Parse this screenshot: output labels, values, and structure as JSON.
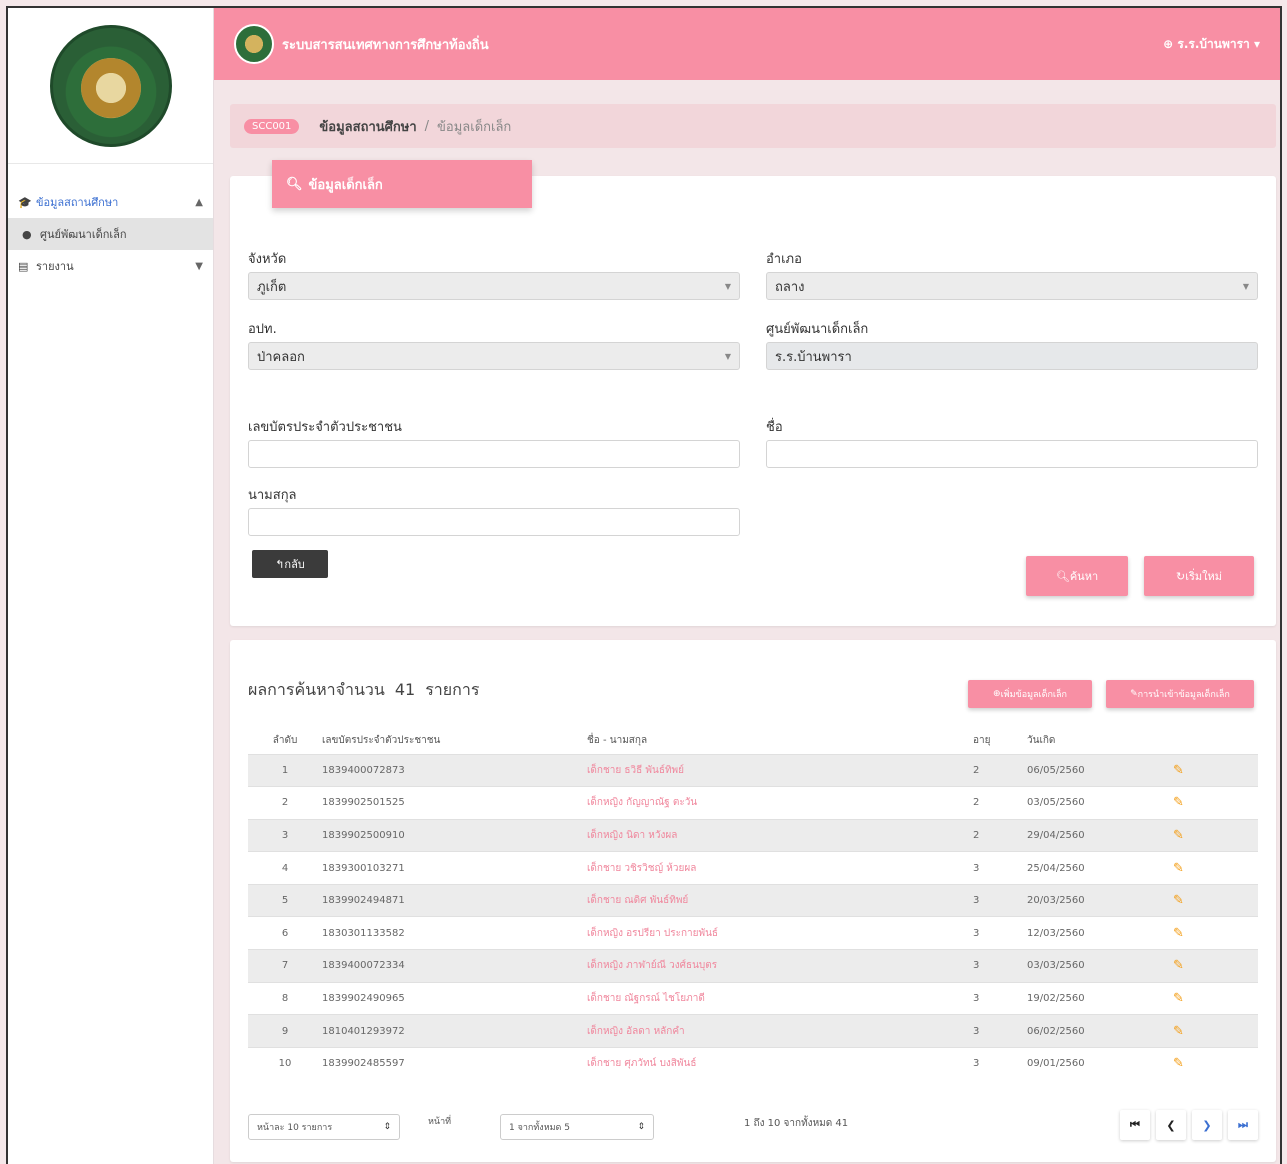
{
  "header": {
    "system_title": "ระบบสารสนเทศทางการศึกษาท้องถิ่น",
    "user": "ร.ร.บ้านพารา"
  },
  "sidebar": {
    "items": [
      {
        "label": "ข้อมูลสถานศึกษา",
        "icon": "graduation-cap-icon"
      },
      {
        "label": "ศูนย์พัฒนาเด็กเล็ก",
        "icon": "circle-icon"
      },
      {
        "label": "รายงาน",
        "icon": "document-icon"
      }
    ]
  },
  "breadcrumb": {
    "code": "SCC001",
    "current": "ข้อมูลสถานศึกษา",
    "separator": "/",
    "last": "ข้อมูลเด็กเล็ก"
  },
  "search": {
    "header": "ข้อมูลเด็กเล็ก",
    "province_label": "จังหวัด",
    "province_value": "ภูเก็ต",
    "district_label": "อำเภอ",
    "district_value": "ถลาง",
    "lao_label": "อปท.",
    "lao_value": "ป่าคลอก",
    "center_label": "ศูนย์พัฒนาเด็กเล็ก",
    "center_value": "ร.ร.บ้านพารา",
    "id_label": "เลขบัตรประจำตัวประชาชน",
    "name_label": "ชื่อ",
    "surname_label": "นามสกุล",
    "back_label": "กลับ",
    "search_label": "ค้นหา",
    "reset_label": "เริ่มใหม่"
  },
  "results": {
    "title_prefix": "ผลการค้นหาจำนวน",
    "count": "41",
    "title_suffix": "รายการ",
    "add_label": "เพิ่มข้อมูลเด็กเล็ก",
    "import_label": "การนำเข้าข้อมูลเด็กเล็ก",
    "columns": [
      "ลำดับ",
      "เลขบัตรประจำตัวประชาชน",
      "ชื่อ - นามสกุล",
      "อายุ",
      "วันเกิด"
    ],
    "rows": [
      {
        "no": "1",
        "id": "1839400072873",
        "name": "เด็กชาย ธวิธี พันธ์ทิพย์",
        "age": "2",
        "dob": "06/05/2560"
      },
      {
        "no": "2",
        "id": "1839902501525",
        "name": "เด็กหญิง กัญญาณัฐ ตะวัน",
        "age": "2",
        "dob": "03/05/2560"
      },
      {
        "no": "3",
        "id": "1839902500910",
        "name": "เด็กหญิง นิดา หวังผล",
        "age": "2",
        "dob": "29/04/2560"
      },
      {
        "no": "4",
        "id": "1839300103271",
        "name": "เด็กชาย วชิรวิชญ์ ห้วยผล",
        "age": "3",
        "dob": "25/04/2560"
      },
      {
        "no": "5",
        "id": "1839902494871",
        "name": "เด็กชาย ณดิศ พันธ์ทิพย์",
        "age": "3",
        "dob": "20/03/2560"
      },
      {
        "no": "6",
        "id": "1830301133582",
        "name": "เด็กหญิง อรปรียา ประกายพันธ์",
        "age": "3",
        "dob": "12/03/2560"
      },
      {
        "no": "7",
        "id": "1839400072334",
        "name": "เด็กหญิง ภาฬาย์ณี วงศ์ธนบุตร",
        "age": "3",
        "dob": "03/03/2560"
      },
      {
        "no": "8",
        "id": "1839902490965",
        "name": "เด็กชาย ณัฐกรณ์ ไชโยภาดี",
        "age": "3",
        "dob": "19/02/2560"
      },
      {
        "no": "9",
        "id": "1810401293972",
        "name": "เด็กหญิง อัลดา หลักคํา",
        "age": "3",
        "dob": "06/02/2560"
      },
      {
        "no": "10",
        "id": "1839902485597",
        "name": "เด็กชาย ศุภวัทน์ บงสิพันธ์",
        "age": "3",
        "dob": "09/01/2560"
      }
    ]
  },
  "pager": {
    "per_page": "หน้าละ 10 รายการ",
    "page_label": "หน้าที่",
    "page_select": "1 จากทั้งหมด 5",
    "summary": "1 ถึง 10 จากทั้งหมด 41",
    "first": "⏮",
    "prev": "❮",
    "next": "❯",
    "last": "⏭"
  },
  "colors": {
    "accent": "#f88fa4",
    "name_link": "#f0869c",
    "edit_icon": "#f39c12"
  }
}
